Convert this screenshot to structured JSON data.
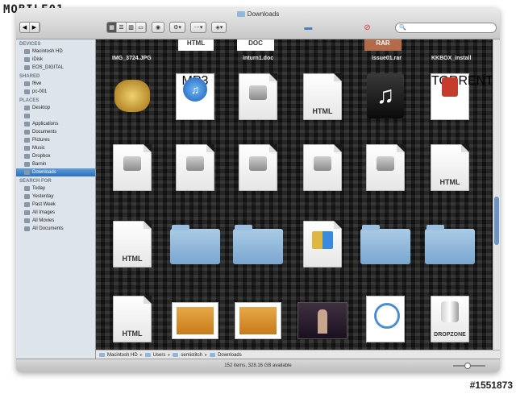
{
  "watermark": {
    "text": "MOBILE01",
    "id": "#1551873"
  },
  "window": {
    "title": "Downloads"
  },
  "search": {
    "placeholder": ""
  },
  "sidebar": {
    "sections": [
      {
        "title": "DEVICES",
        "items": [
          "Macintosh HD",
          "iDisk",
          "EOS_DIGITAL"
        ]
      },
      {
        "title": "SHARED",
        "items": [
          "f6ve",
          "pc-001"
        ]
      },
      {
        "title": "PLACES",
        "items": [
          "Desktop",
          "",
          "Applications",
          "Documents",
          "Pictures",
          "Music",
          "Dropbox",
          "Barnin",
          "Downloads"
        ]
      },
      {
        "title": "SEARCH FOR",
        "items": [
          "Today",
          "Yesterday",
          "Past Week",
          "All Images",
          "All Movies",
          "All Documents"
        ]
      }
    ],
    "selected": "Downloads"
  },
  "top_row": {
    "labels": [
      "IMG_3724.JPG",
      "inturn1.doc",
      "issue01.rar",
      "KKBOX_install"
    ],
    "doc_labels": [
      "HTML",
      "DOC",
      "RAR"
    ]
  },
  "files": [
    {
      "name": "",
      "kind": "insect"
    },
    {
      "name": "",
      "kind": "mp3",
      "label": "MP3"
    },
    {
      "name": "",
      "kind": "disk"
    },
    {
      "name": "",
      "kind": "html",
      "label": "HTML"
    },
    {
      "name": "",
      "kind": "music"
    },
    {
      "name": "",
      "kind": "torrent",
      "label": "TORRENT"
    },
    {
      "name": "",
      "kind": "disk"
    },
    {
      "name": "",
      "kind": "disk"
    },
    {
      "name": "",
      "kind": "disk"
    },
    {
      "name": "",
      "kind": "disk"
    },
    {
      "name": "",
      "kind": "disk"
    },
    {
      "name": "",
      "kind": "html",
      "label": "HTML"
    },
    {
      "name": "",
      "kind": "html",
      "label": "HTML"
    },
    {
      "name": "",
      "kind": "folder"
    },
    {
      "name": "",
      "kind": "folder"
    },
    {
      "name": "",
      "kind": "winzip"
    },
    {
      "name": "",
      "kind": "folder"
    },
    {
      "name": "",
      "kind": "folder"
    },
    {
      "name": "",
      "kind": "html",
      "label": "HTML"
    },
    {
      "name": "",
      "kind": "orange"
    },
    {
      "name": "",
      "kind": "orange"
    },
    {
      "name": "",
      "kind": "video"
    },
    {
      "name": "",
      "kind": "quicktime"
    },
    {
      "name": "",
      "kind": "dropzone",
      "label": "DROPZONE"
    }
  ],
  "pathbar": [
    "Macintosh HD",
    "Users",
    "semistitch",
    "Downloads"
  ],
  "status": "152 items, 328.16 GB available"
}
